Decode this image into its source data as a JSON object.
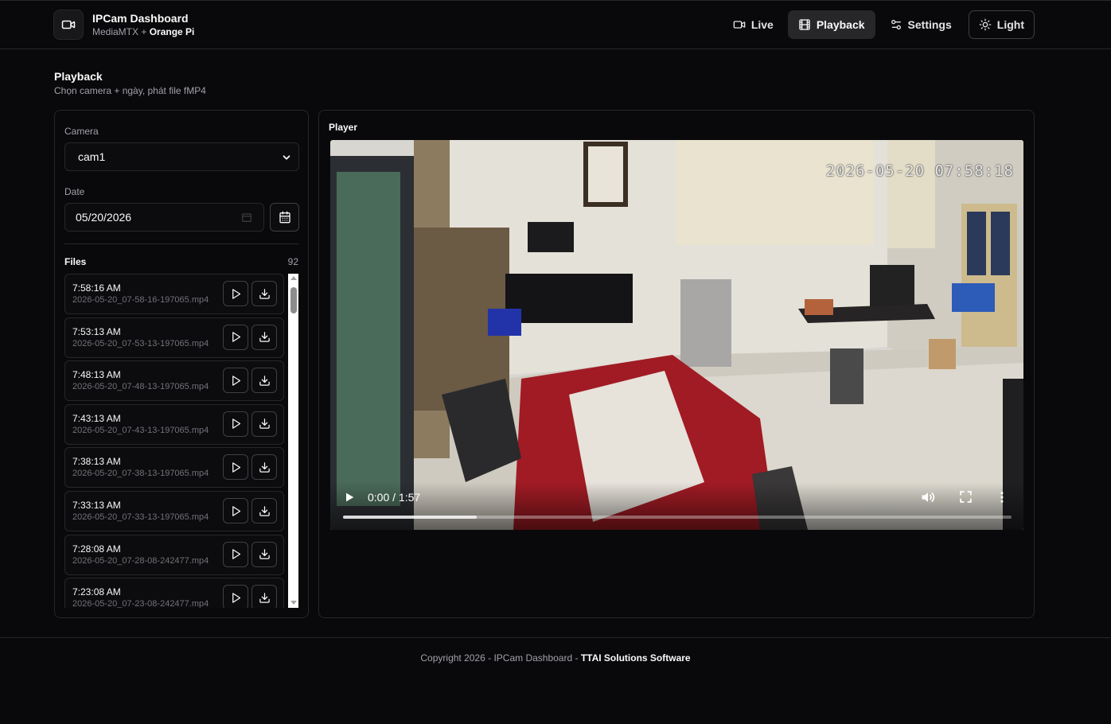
{
  "header": {
    "title": "IPCam Dashboard",
    "subtitle_prefix": "MediaMTX +",
    "subtitle_strong": "Orange Pi",
    "nav": {
      "live": "Live",
      "playback": "Playback",
      "settings": "Settings",
      "theme": "Light"
    }
  },
  "page": {
    "title": "Playback",
    "subtitle": "Chọn camera + ngày, phát file fMP4"
  },
  "filters": {
    "camera_label": "Camera",
    "camera_value": "cam1",
    "date_label": "Date",
    "date_value": "05/20/2026"
  },
  "files": {
    "title": "Files",
    "count": "92",
    "items": [
      {
        "time": "7:58:16 AM",
        "name": "2026-05-20_07-58-16-197065.mp4"
      },
      {
        "time": "7:53:13 AM",
        "name": "2026-05-20_07-53-13-197065.mp4"
      },
      {
        "time": "7:48:13 AM",
        "name": "2026-05-20_07-48-13-197065.mp4"
      },
      {
        "time": "7:43:13 AM",
        "name": "2026-05-20_07-43-13-197065.mp4"
      },
      {
        "time": "7:38:13 AM",
        "name": "2026-05-20_07-38-13-197065.mp4"
      },
      {
        "time": "7:33:13 AM",
        "name": "2026-05-20_07-33-13-197065.mp4"
      },
      {
        "time": "7:28:08 AM",
        "name": "2026-05-20_07-28-08-242477.mp4"
      },
      {
        "time": "7:23:08 AM",
        "name": "2026-05-20_07-23-08-242477.mp4"
      }
    ]
  },
  "player": {
    "title": "Player",
    "overlay_timestamp": "2026-05-20 07:58:18",
    "time_display": "0:00 / 1:57",
    "buffered_fraction": 0.2
  },
  "footer": {
    "text": "Copyright 2026 - IPCam Dashboard -",
    "strong": "TTAI Solutions Software"
  },
  "colors": {
    "background": "#09090b",
    "border": "#27272a",
    "muted": "#a1a1aa",
    "active_nav": "#27272a"
  }
}
